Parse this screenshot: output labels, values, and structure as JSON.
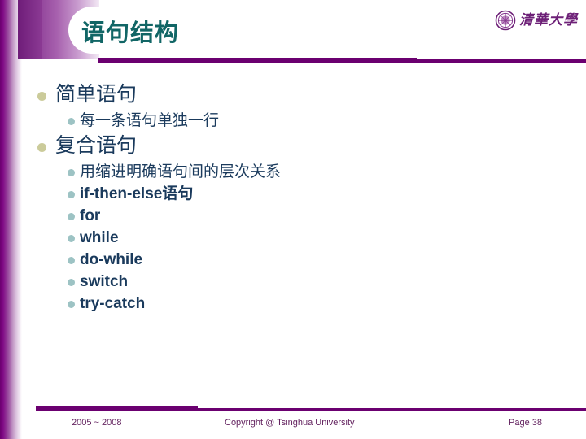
{
  "slide": {
    "title": "语句结构",
    "title_color": "#116666",
    "accent_color": "#6b0070",
    "text_color": "#1a3a5c",
    "bullet1_color": "#cbcb9a",
    "bullet2_color": "#9dc3c4"
  },
  "logo": {
    "emblem_name": "tsinghua-emblem-icon",
    "wordmark": "清華大學"
  },
  "outline": [
    {
      "level": 1,
      "text": "简单语句",
      "children": [
        {
          "level": 2,
          "text": "每一条语句单独一行",
          "script": "cn"
        }
      ]
    },
    {
      "level": 1,
      "text": "复合语句",
      "children": [
        {
          "level": 2,
          "text": "用缩进明确语句间的层次关系",
          "script": "cn"
        },
        {
          "level": 2,
          "text": "if-then-else语句",
          "script": "mixed"
        },
        {
          "level": 2,
          "text": "for",
          "script": "en"
        },
        {
          "level": 2,
          "text": "while",
          "script": "en"
        },
        {
          "level": 2,
          "text": "do-while",
          "script": "en"
        },
        {
          "level": 2,
          "text": "switch",
          "script": "en"
        },
        {
          "level": 2,
          "text": "try-catch",
          "script": "en"
        }
      ]
    }
  ],
  "footer": {
    "date_range": "2005 ~ 2008",
    "copyright": "Copyright @ Tsinghua University",
    "page": "Page 38"
  }
}
